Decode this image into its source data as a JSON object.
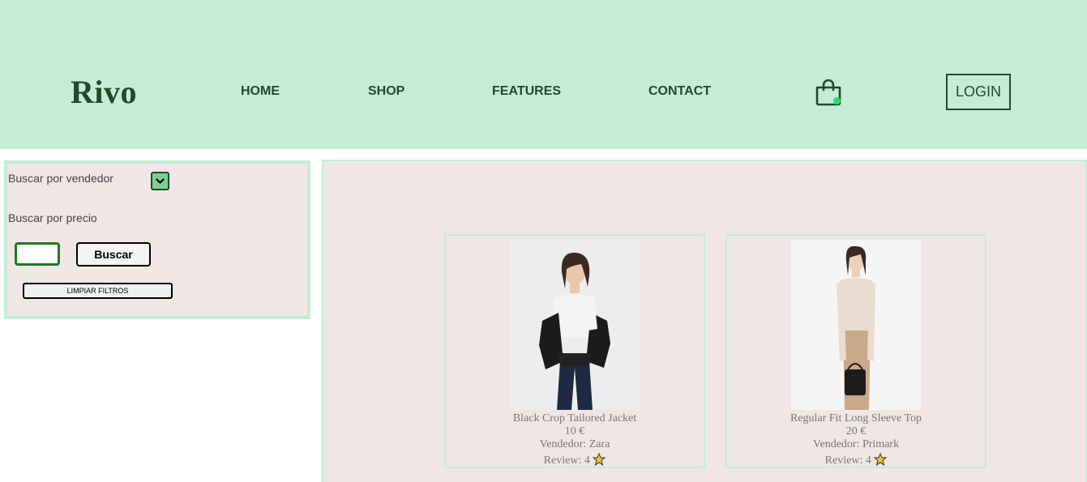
{
  "header": {
    "logo": "Rivo",
    "nav": [
      {
        "label": "HOME"
      },
      {
        "label": "SHOP"
      },
      {
        "label": "FEATURES"
      },
      {
        "label": "CONTACT"
      }
    ],
    "login_label": "LOGIN",
    "cart_icon": "shopping-bag-icon",
    "cart_status_color": "#22e06a"
  },
  "filters": {
    "vendor_label": "Buscar por vendedor",
    "price_label": "Buscar por precio",
    "price_value": "",
    "search_label": "Buscar",
    "clear_label": "LIMPIAR FILTROS"
  },
  "products": [
    {
      "name": "Black Crop Tailored Jacket",
      "price": "10 €",
      "vendor": "Vendedor: Zara",
      "review": "Review: 4",
      "rating_icon": "star-icon"
    },
    {
      "name": "Regular Fit Long Sleeve Top",
      "price": "20 €",
      "vendor": "Vendedor: Primark",
      "review": "Review: 4",
      "rating_icon": "star-icon"
    }
  ],
  "colors": {
    "header_bg": "#c3eed4",
    "panel_bg": "#f0e6e6",
    "brand_dark": "#1f4a2d"
  }
}
